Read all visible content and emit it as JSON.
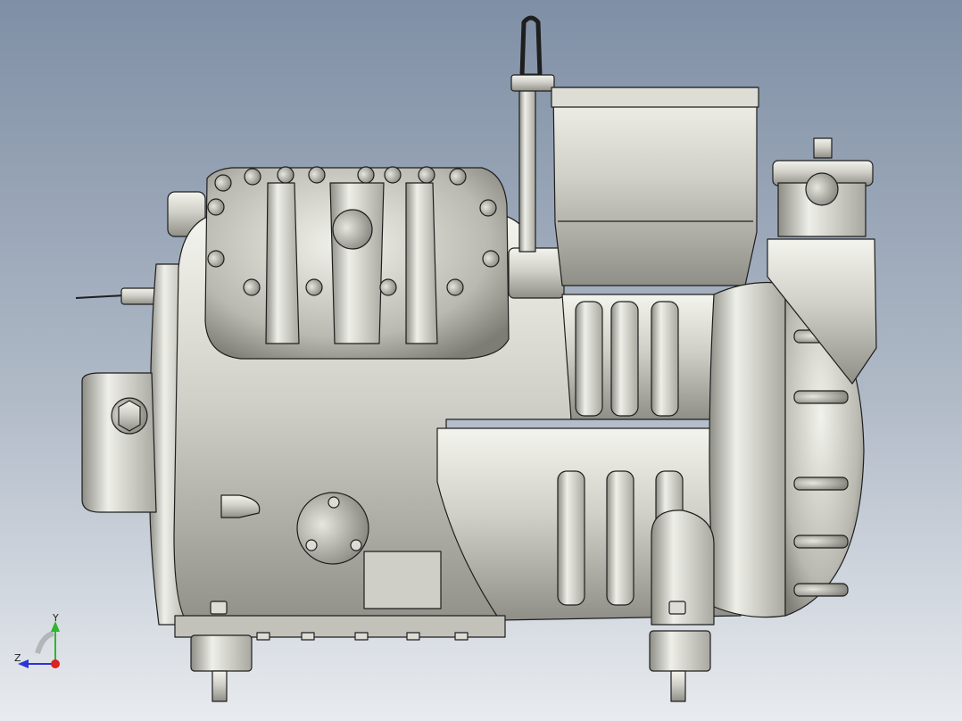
{
  "viewport": {
    "background_top": "#7f8fa5",
    "background_bottom": "#e8ebef",
    "model_fill": "#d7d7cf",
    "model_shadow": "#8d8d86",
    "model_edge": "#1e1e1e"
  },
  "triad": {
    "y_label": "Y",
    "z_label": "Z",
    "y_color": "#2fb52f",
    "z_color": "#2a35d4",
    "origin_color": "#e02020"
  }
}
